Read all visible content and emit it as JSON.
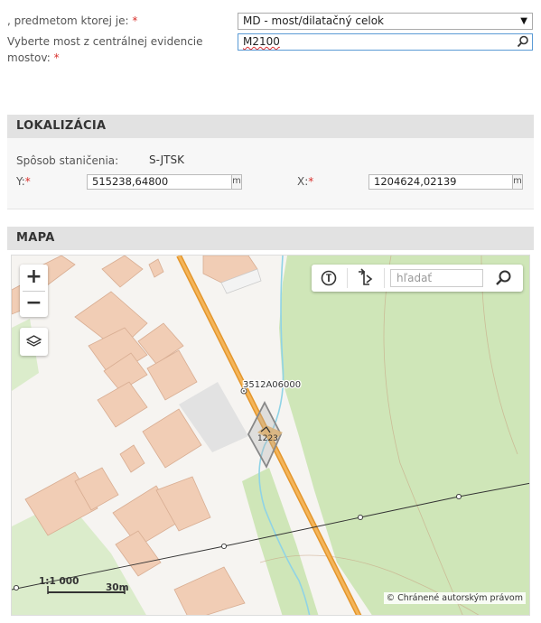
{
  "form": {
    "subject_label": ", predmetom ktorej je:",
    "subject_required": "*",
    "subject_value": "MD - most/dilatačný celok",
    "bridge_label_line1": "Vyberte most z centrálnej evidencie",
    "bridge_label_line2": "mostov:",
    "bridge_required": "*",
    "bridge_value": "M2100"
  },
  "localization": {
    "title": "LOKALIZÁCIA",
    "method_label": "Spôsob staničenia:",
    "method_value": "S-JTSK",
    "y_label": "Y:",
    "y_required": "*",
    "y_value": "515238,64800",
    "y_unit": "m",
    "x_label": "X:",
    "x_required": "*",
    "x_value": "1204624,02139",
    "x_unit": "m"
  },
  "map": {
    "title": "MAPA",
    "zoom_in": "+",
    "zoom_out": "−",
    "search_placeholder": "hľadať",
    "road_label": "3512A06000",
    "bridge_label": "1223",
    "scale_ratio": "1:1 000",
    "scale_distance": "30m",
    "copyright": "© Chránené autorským právom"
  },
  "colors": {
    "building": "#f1cdb5",
    "building_stroke": "#d8ad92",
    "greenery": "#cfe6b8",
    "river": "#8fd3e6",
    "road": "#f0a53a",
    "required": "#d9302c",
    "section_header": "#e2e2e2"
  }
}
